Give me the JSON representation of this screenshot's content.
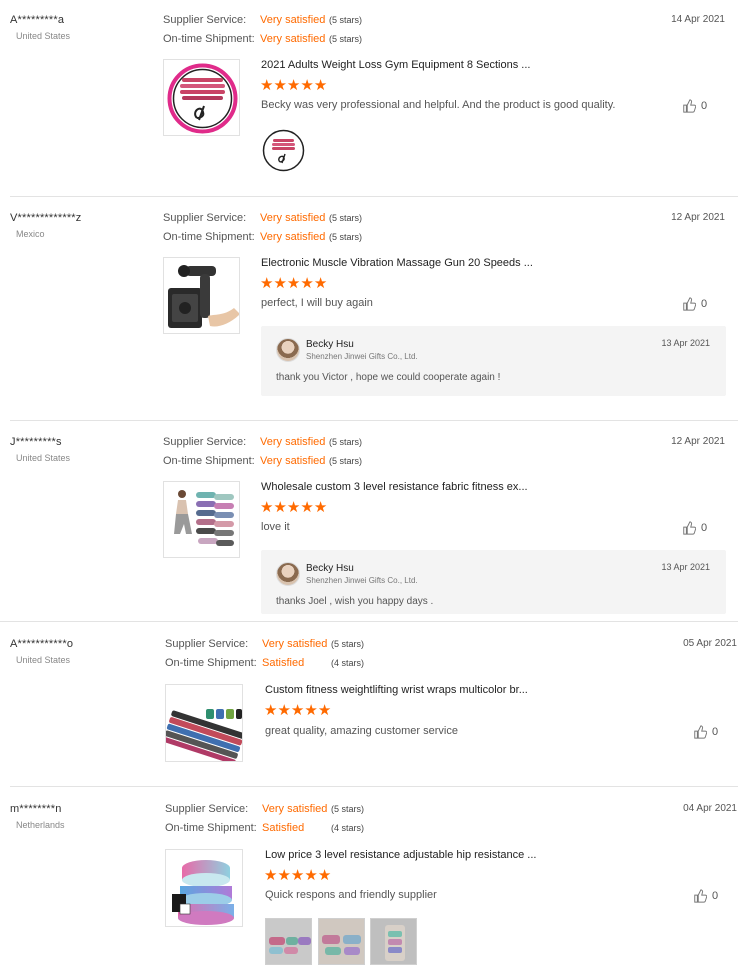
{
  "labels": {
    "supplier_service": "Supplier Service:",
    "on_time_shipment": "On-time Shipment:"
  },
  "reviews": [
    {
      "buyer": "A*********a",
      "country": "United States",
      "date": "14 Apr 2021",
      "supplier_service": "Very satisfied",
      "supplier_service_stars": "(5 stars)",
      "shipment": "Very satisfied",
      "shipment_stars": "(5 stars)",
      "product_title": "2021 Adults Weight Loss Gym Equipment 8 Sections ...",
      "stars": 5,
      "comment": "Becky was very professional and helpful. And the product is good quality.",
      "likes": "0"
    },
    {
      "buyer": "V*************z",
      "country": "Mexico",
      "date": "12 Apr 2021",
      "supplier_service": "Very satisfied",
      "supplier_service_stars": "(5 stars)",
      "shipment": "Very satisfied",
      "shipment_stars": "(5 stars)",
      "product_title": "Electronic Muscle Vibration Massage Gun 20 Speeds ...",
      "stars": 5,
      "comment": "perfect, I will buy again",
      "likes": "0",
      "reply": {
        "name": "Becky Hsu",
        "company": "Shenzhen Jinwei Gifts Co., Ltd.",
        "date": "13 Apr 2021",
        "text": "thank you Victor  , hope we could cooperate again !"
      }
    },
    {
      "buyer": "J*********s",
      "country": "United States",
      "date": "12 Apr 2021",
      "supplier_service": "Very satisfied",
      "supplier_service_stars": "(5 stars)",
      "shipment": "Very satisfied",
      "shipment_stars": "(5 stars)",
      "product_title": "Wholesale custom 3 level resistance fabric fitness ex...",
      "stars": 5,
      "comment": "love it",
      "likes": "0",
      "reply": {
        "name": "Becky Hsu",
        "company": "Shenzhen Jinwei Gifts Co., Ltd.",
        "date": "13 Apr 2021",
        "text": "thanks Joel  , wish you happy days ."
      }
    },
    {
      "buyer": "A***********o",
      "country": "United States",
      "date": "05 Apr 2021",
      "supplier_service": "Very satisfied",
      "supplier_service_stars": "(5 stars)",
      "shipment": "Satisfied",
      "shipment_stars": "(4 stars)",
      "product_title": "Custom fitness weightlifting wrist wraps multicolor br...",
      "stars": 5,
      "comment": "great quality, amazing customer service",
      "likes": "0"
    },
    {
      "buyer": "m********n",
      "country": "Netherlands",
      "date": "04 Apr 2021",
      "supplier_service": "Very satisfied",
      "supplier_service_stars": "(5 stars)",
      "shipment": "Satisfied",
      "shipment_stars": "(4 stars)",
      "product_title": "Low price 3 level resistance adjustable hip resistance ...",
      "stars": 5,
      "comment": "Quick respons and friendly supplier",
      "likes": "0"
    }
  ],
  "colors": {
    "accent": "#ff6a00",
    "divider": "#e3e3e3",
    "reply_bg": "#f4f4f4"
  },
  "icons": {
    "like": "thumbs-up-icon",
    "star": "star-icon"
  }
}
